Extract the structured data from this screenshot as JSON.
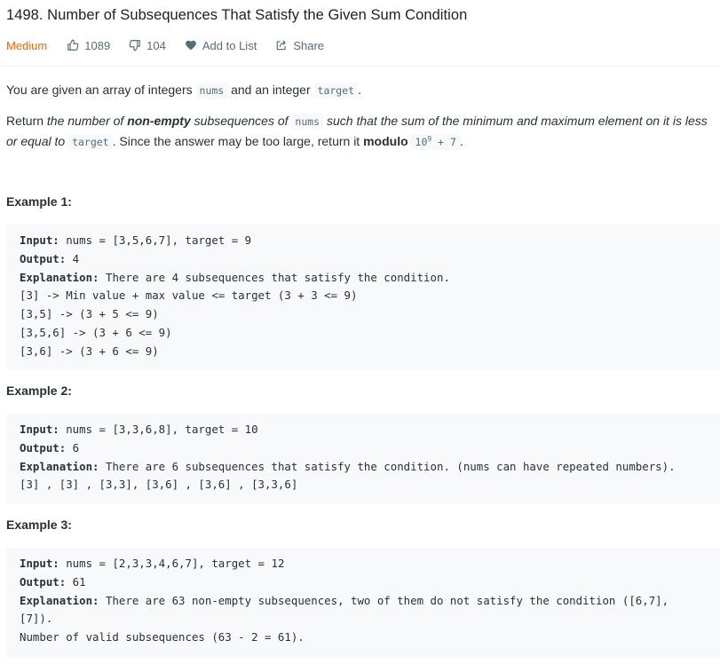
{
  "problem": {
    "title": "1498. Number of Subsequences That Satisfy the Given Sum Condition",
    "difficulty": "Medium",
    "likes": "1089",
    "dislikes": "104",
    "add_to_list": "Add to List",
    "share": "Share"
  },
  "description": {
    "p1_a": "You are given an array of integers ",
    "p1_code1": "nums",
    "p1_b": " and an integer ",
    "p1_code2": "target",
    "p1_c": ".",
    "p2_a": "Return ",
    "p2_em1": "the number of ",
    "p2_strong1": "non-empty",
    "p2_em2": " subsequences of ",
    "p2_code1": "nums",
    "p2_em3": " such that the sum of the minimum and maximum element on it is less or equal to ",
    "p2_code2": "target",
    "p2_b": ". Since the answer may be too large, return it ",
    "p2_strong2": "modulo",
    "p2_mod_base": "10",
    "p2_mod_exp": "9",
    "p2_mod_tail": " + 7",
    "p2_end": "."
  },
  "labels": {
    "input": "Input:",
    "output": "Output:",
    "explanation": "Explanation:"
  },
  "examples": [
    {
      "title": "Example 1:",
      "input": " nums = [3,5,6,7], target = 9",
      "output": " 4",
      "explanation": " There are 4 subsequences that satisfy the condition.",
      "extra": "[3] -> Min value + max value <= target (3 + 3 <= 9)\n[3,5] -> (3 + 5 <= 9)\n[3,5,6] -> (3 + 6 <= 9)\n[3,6] -> (3 + 6 <= 9)"
    },
    {
      "title": "Example 2:",
      "input": " nums = [3,3,6,8], target = 10",
      "output": " 6",
      "explanation": " There are 6 subsequences that satisfy the condition. (nums can have repeated numbers).",
      "extra": "[3] , [3] , [3,3], [3,6] , [3,6] , [3,3,6]"
    },
    {
      "title": "Example 3:",
      "input": " nums = [2,3,3,4,6,7], target = 12",
      "output": " 61",
      "explanation": " There are 63 non-empty subsequences, two of them do not satisfy the condition ([6,7], \n[7]).",
      "extra": "Number of valid subsequences (63 - 2 = 61)."
    }
  ],
  "icons": {
    "like": "thumbs-up-icon",
    "dislike": "thumbs-down-icon",
    "add_to_list": "heart-icon",
    "share": "share-icon"
  },
  "colors": {
    "difficulty_medium": "#ef6c00",
    "code_background": "#f7f9fa"
  }
}
